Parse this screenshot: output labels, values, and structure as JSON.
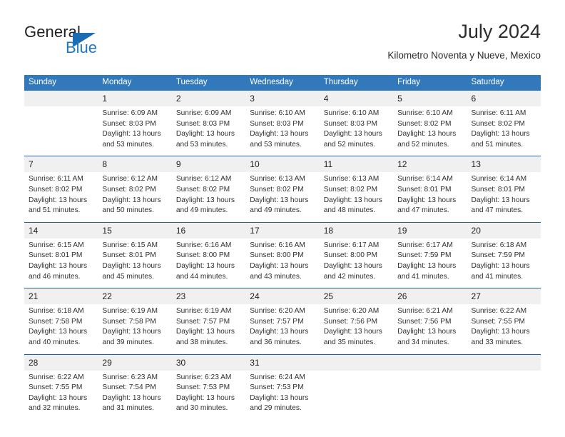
{
  "logo": {
    "word_one": "General",
    "word_two": "Blue",
    "icon": "triangle-logo-icon"
  },
  "header": {
    "title": "July 2024",
    "subtitle": "Kilometro Noventa y Nueve, Mexico"
  },
  "colors": {
    "header_blue": "#3179ba",
    "row_divider_blue": "#1f62a8",
    "daynum_band": "#f0f0f0",
    "logo_blue": "#1f78c1",
    "text": "#303030"
  },
  "weekdays": [
    "Sunday",
    "Monday",
    "Tuesday",
    "Wednesday",
    "Thursday",
    "Friday",
    "Saturday"
  ],
  "weeks": [
    [
      {
        "day": "",
        "sunrise": "",
        "sunset": "",
        "daylight_1": "",
        "daylight_2": ""
      },
      {
        "day": "1",
        "sunrise": "Sunrise: 6:09 AM",
        "sunset": "Sunset: 8:03 PM",
        "daylight_1": "Daylight: 13 hours",
        "daylight_2": "and 53 minutes."
      },
      {
        "day": "2",
        "sunrise": "Sunrise: 6:09 AM",
        "sunset": "Sunset: 8:03 PM",
        "daylight_1": "Daylight: 13 hours",
        "daylight_2": "and 53 minutes."
      },
      {
        "day": "3",
        "sunrise": "Sunrise: 6:10 AM",
        "sunset": "Sunset: 8:03 PM",
        "daylight_1": "Daylight: 13 hours",
        "daylight_2": "and 53 minutes."
      },
      {
        "day": "4",
        "sunrise": "Sunrise: 6:10 AM",
        "sunset": "Sunset: 8:03 PM",
        "daylight_1": "Daylight: 13 hours",
        "daylight_2": "and 52 minutes."
      },
      {
        "day": "5",
        "sunrise": "Sunrise: 6:10 AM",
        "sunset": "Sunset: 8:02 PM",
        "daylight_1": "Daylight: 13 hours",
        "daylight_2": "and 52 minutes."
      },
      {
        "day": "6",
        "sunrise": "Sunrise: 6:11 AM",
        "sunset": "Sunset: 8:02 PM",
        "daylight_1": "Daylight: 13 hours",
        "daylight_2": "and 51 minutes."
      }
    ],
    [
      {
        "day": "7",
        "sunrise": "Sunrise: 6:11 AM",
        "sunset": "Sunset: 8:02 PM",
        "daylight_1": "Daylight: 13 hours",
        "daylight_2": "and 51 minutes."
      },
      {
        "day": "8",
        "sunrise": "Sunrise: 6:12 AM",
        "sunset": "Sunset: 8:02 PM",
        "daylight_1": "Daylight: 13 hours",
        "daylight_2": "and 50 minutes."
      },
      {
        "day": "9",
        "sunrise": "Sunrise: 6:12 AM",
        "sunset": "Sunset: 8:02 PM",
        "daylight_1": "Daylight: 13 hours",
        "daylight_2": "and 49 minutes."
      },
      {
        "day": "10",
        "sunrise": "Sunrise: 6:13 AM",
        "sunset": "Sunset: 8:02 PM",
        "daylight_1": "Daylight: 13 hours",
        "daylight_2": "and 49 minutes."
      },
      {
        "day": "11",
        "sunrise": "Sunrise: 6:13 AM",
        "sunset": "Sunset: 8:02 PM",
        "daylight_1": "Daylight: 13 hours",
        "daylight_2": "and 48 minutes."
      },
      {
        "day": "12",
        "sunrise": "Sunrise: 6:14 AM",
        "sunset": "Sunset: 8:01 PM",
        "daylight_1": "Daylight: 13 hours",
        "daylight_2": "and 47 minutes."
      },
      {
        "day": "13",
        "sunrise": "Sunrise: 6:14 AM",
        "sunset": "Sunset: 8:01 PM",
        "daylight_1": "Daylight: 13 hours",
        "daylight_2": "and 47 minutes."
      }
    ],
    [
      {
        "day": "14",
        "sunrise": "Sunrise: 6:15 AM",
        "sunset": "Sunset: 8:01 PM",
        "daylight_1": "Daylight: 13 hours",
        "daylight_2": "and 46 minutes."
      },
      {
        "day": "15",
        "sunrise": "Sunrise: 6:15 AM",
        "sunset": "Sunset: 8:01 PM",
        "daylight_1": "Daylight: 13 hours",
        "daylight_2": "and 45 minutes."
      },
      {
        "day": "16",
        "sunrise": "Sunrise: 6:16 AM",
        "sunset": "Sunset: 8:00 PM",
        "daylight_1": "Daylight: 13 hours",
        "daylight_2": "and 44 minutes."
      },
      {
        "day": "17",
        "sunrise": "Sunrise: 6:16 AM",
        "sunset": "Sunset: 8:00 PM",
        "daylight_1": "Daylight: 13 hours",
        "daylight_2": "and 43 minutes."
      },
      {
        "day": "18",
        "sunrise": "Sunrise: 6:17 AM",
        "sunset": "Sunset: 8:00 PM",
        "daylight_1": "Daylight: 13 hours",
        "daylight_2": "and 42 minutes."
      },
      {
        "day": "19",
        "sunrise": "Sunrise: 6:17 AM",
        "sunset": "Sunset: 7:59 PM",
        "daylight_1": "Daylight: 13 hours",
        "daylight_2": "and 41 minutes."
      },
      {
        "day": "20",
        "sunrise": "Sunrise: 6:18 AM",
        "sunset": "Sunset: 7:59 PM",
        "daylight_1": "Daylight: 13 hours",
        "daylight_2": "and 41 minutes."
      }
    ],
    [
      {
        "day": "21",
        "sunrise": "Sunrise: 6:18 AM",
        "sunset": "Sunset: 7:58 PM",
        "daylight_1": "Daylight: 13 hours",
        "daylight_2": "and 40 minutes."
      },
      {
        "day": "22",
        "sunrise": "Sunrise: 6:19 AM",
        "sunset": "Sunset: 7:58 PM",
        "daylight_1": "Daylight: 13 hours",
        "daylight_2": "and 39 minutes."
      },
      {
        "day": "23",
        "sunrise": "Sunrise: 6:19 AM",
        "sunset": "Sunset: 7:57 PM",
        "daylight_1": "Daylight: 13 hours",
        "daylight_2": "and 38 minutes."
      },
      {
        "day": "24",
        "sunrise": "Sunrise: 6:20 AM",
        "sunset": "Sunset: 7:57 PM",
        "daylight_1": "Daylight: 13 hours",
        "daylight_2": "and 36 minutes."
      },
      {
        "day": "25",
        "sunrise": "Sunrise: 6:20 AM",
        "sunset": "Sunset: 7:56 PM",
        "daylight_1": "Daylight: 13 hours",
        "daylight_2": "and 35 minutes."
      },
      {
        "day": "26",
        "sunrise": "Sunrise: 6:21 AM",
        "sunset": "Sunset: 7:56 PM",
        "daylight_1": "Daylight: 13 hours",
        "daylight_2": "and 34 minutes."
      },
      {
        "day": "27",
        "sunrise": "Sunrise: 6:22 AM",
        "sunset": "Sunset: 7:55 PM",
        "daylight_1": "Daylight: 13 hours",
        "daylight_2": "and 33 minutes."
      }
    ],
    [
      {
        "day": "28",
        "sunrise": "Sunrise: 6:22 AM",
        "sunset": "Sunset: 7:55 PM",
        "daylight_1": "Daylight: 13 hours",
        "daylight_2": "and 32 minutes."
      },
      {
        "day": "29",
        "sunrise": "Sunrise: 6:23 AM",
        "sunset": "Sunset: 7:54 PM",
        "daylight_1": "Daylight: 13 hours",
        "daylight_2": "and 31 minutes."
      },
      {
        "day": "30",
        "sunrise": "Sunrise: 6:23 AM",
        "sunset": "Sunset: 7:53 PM",
        "daylight_1": "Daylight: 13 hours",
        "daylight_2": "and 30 minutes."
      },
      {
        "day": "31",
        "sunrise": "Sunrise: 6:24 AM",
        "sunset": "Sunset: 7:53 PM",
        "daylight_1": "Daylight: 13 hours",
        "daylight_2": "and 29 minutes."
      },
      {
        "day": "",
        "sunrise": "",
        "sunset": "",
        "daylight_1": "",
        "daylight_2": ""
      },
      {
        "day": "",
        "sunrise": "",
        "sunset": "",
        "daylight_1": "",
        "daylight_2": ""
      },
      {
        "day": "",
        "sunrise": "",
        "sunset": "",
        "daylight_1": "",
        "daylight_2": ""
      }
    ]
  ]
}
